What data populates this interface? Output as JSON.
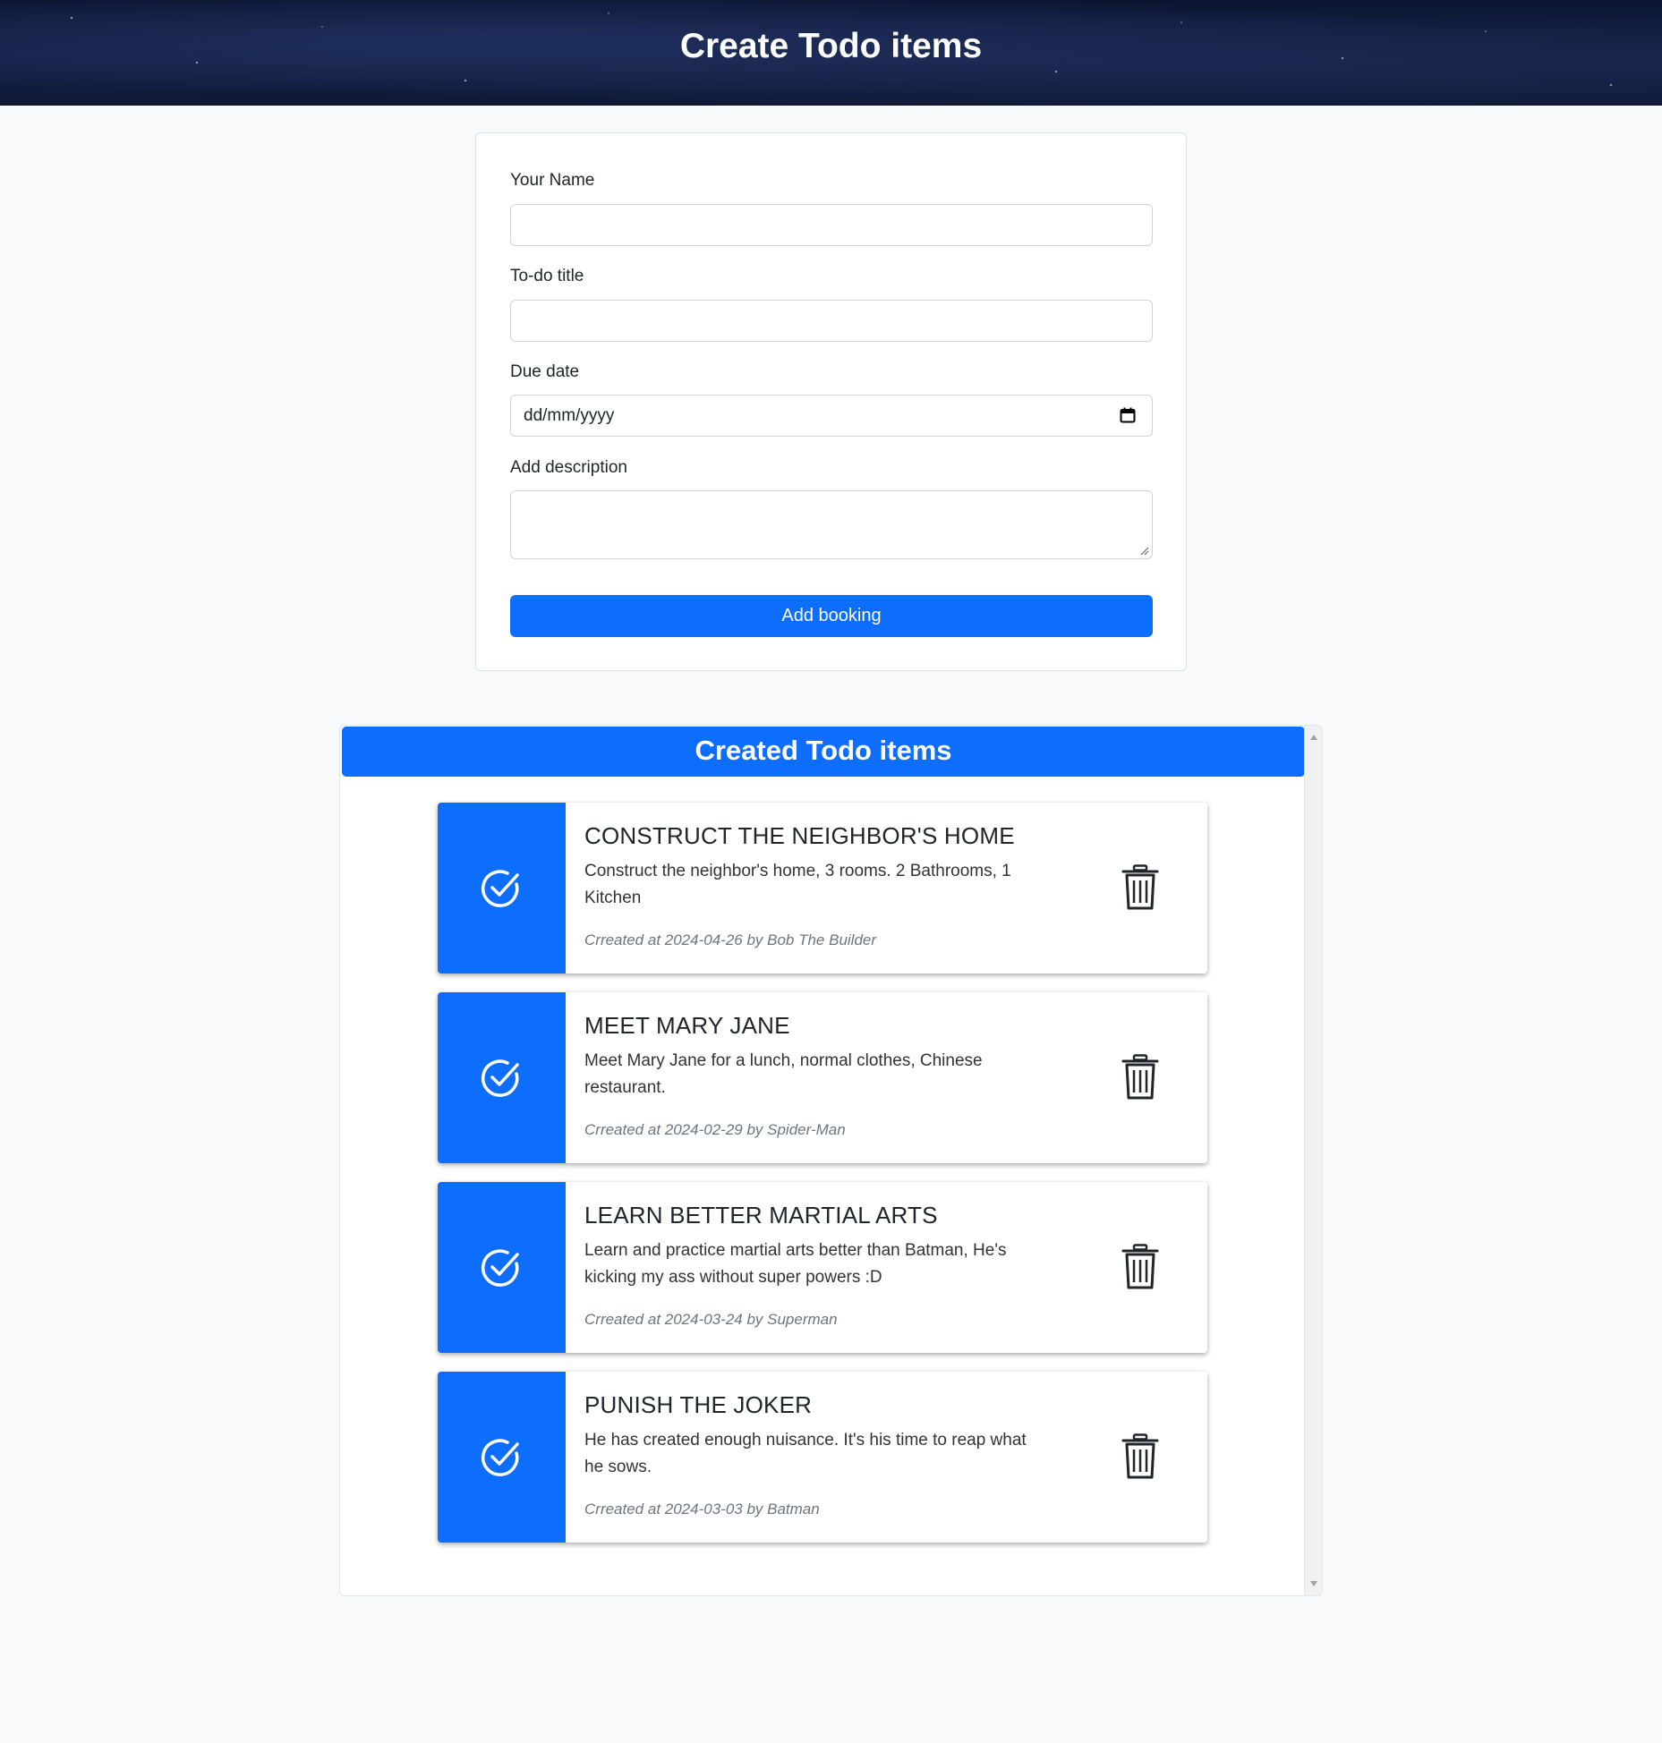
{
  "header": {
    "title": "Create Todo items"
  },
  "form": {
    "name_label": "Your Name",
    "name_value": "",
    "title_label": "To-do title",
    "title_value": "",
    "due_label": "Due date",
    "due_placeholder": "dd/mm/yyyy",
    "description_label": "Add description",
    "description_value": "",
    "submit_label": "Add booking"
  },
  "list": {
    "heading": "Created Todo items",
    "items": [
      {
        "title": "CONSTRUCT THE NEIGHBOR'S HOME",
        "description": "Construct the neighbor's home, 3 rooms. 2 Bathrooms, 1 Kitchen",
        "meta": "Crreated at 2024-04-26 by Bob The Builder"
      },
      {
        "title": "MEET MARY JANE",
        "description": "Meet Mary Jane for a lunch, normal clothes, Chinese restaurant.",
        "meta": "Crreated at 2024-02-29 by Spider-Man"
      },
      {
        "title": "LEARN BETTER MARTIAL ARTS",
        "description": "Learn and practice martial arts better than Batman, He's kicking my ass without super powers :D",
        "meta": "Crreated at 2024-03-24 by Superman"
      },
      {
        "title": "PUNISH THE JOKER",
        "description": "He has created enough nuisance. It's his time to reap what he sows.",
        "meta": "Crreated at 2024-03-03 by Batman"
      }
    ]
  },
  "colors": {
    "primary": "#0d6efd",
    "page_bg": "#f8f9fa",
    "header_bg": "#142247"
  },
  "icons": {
    "check": "check-circle-icon",
    "delete": "trash-icon",
    "calendar": "calendar-icon"
  }
}
